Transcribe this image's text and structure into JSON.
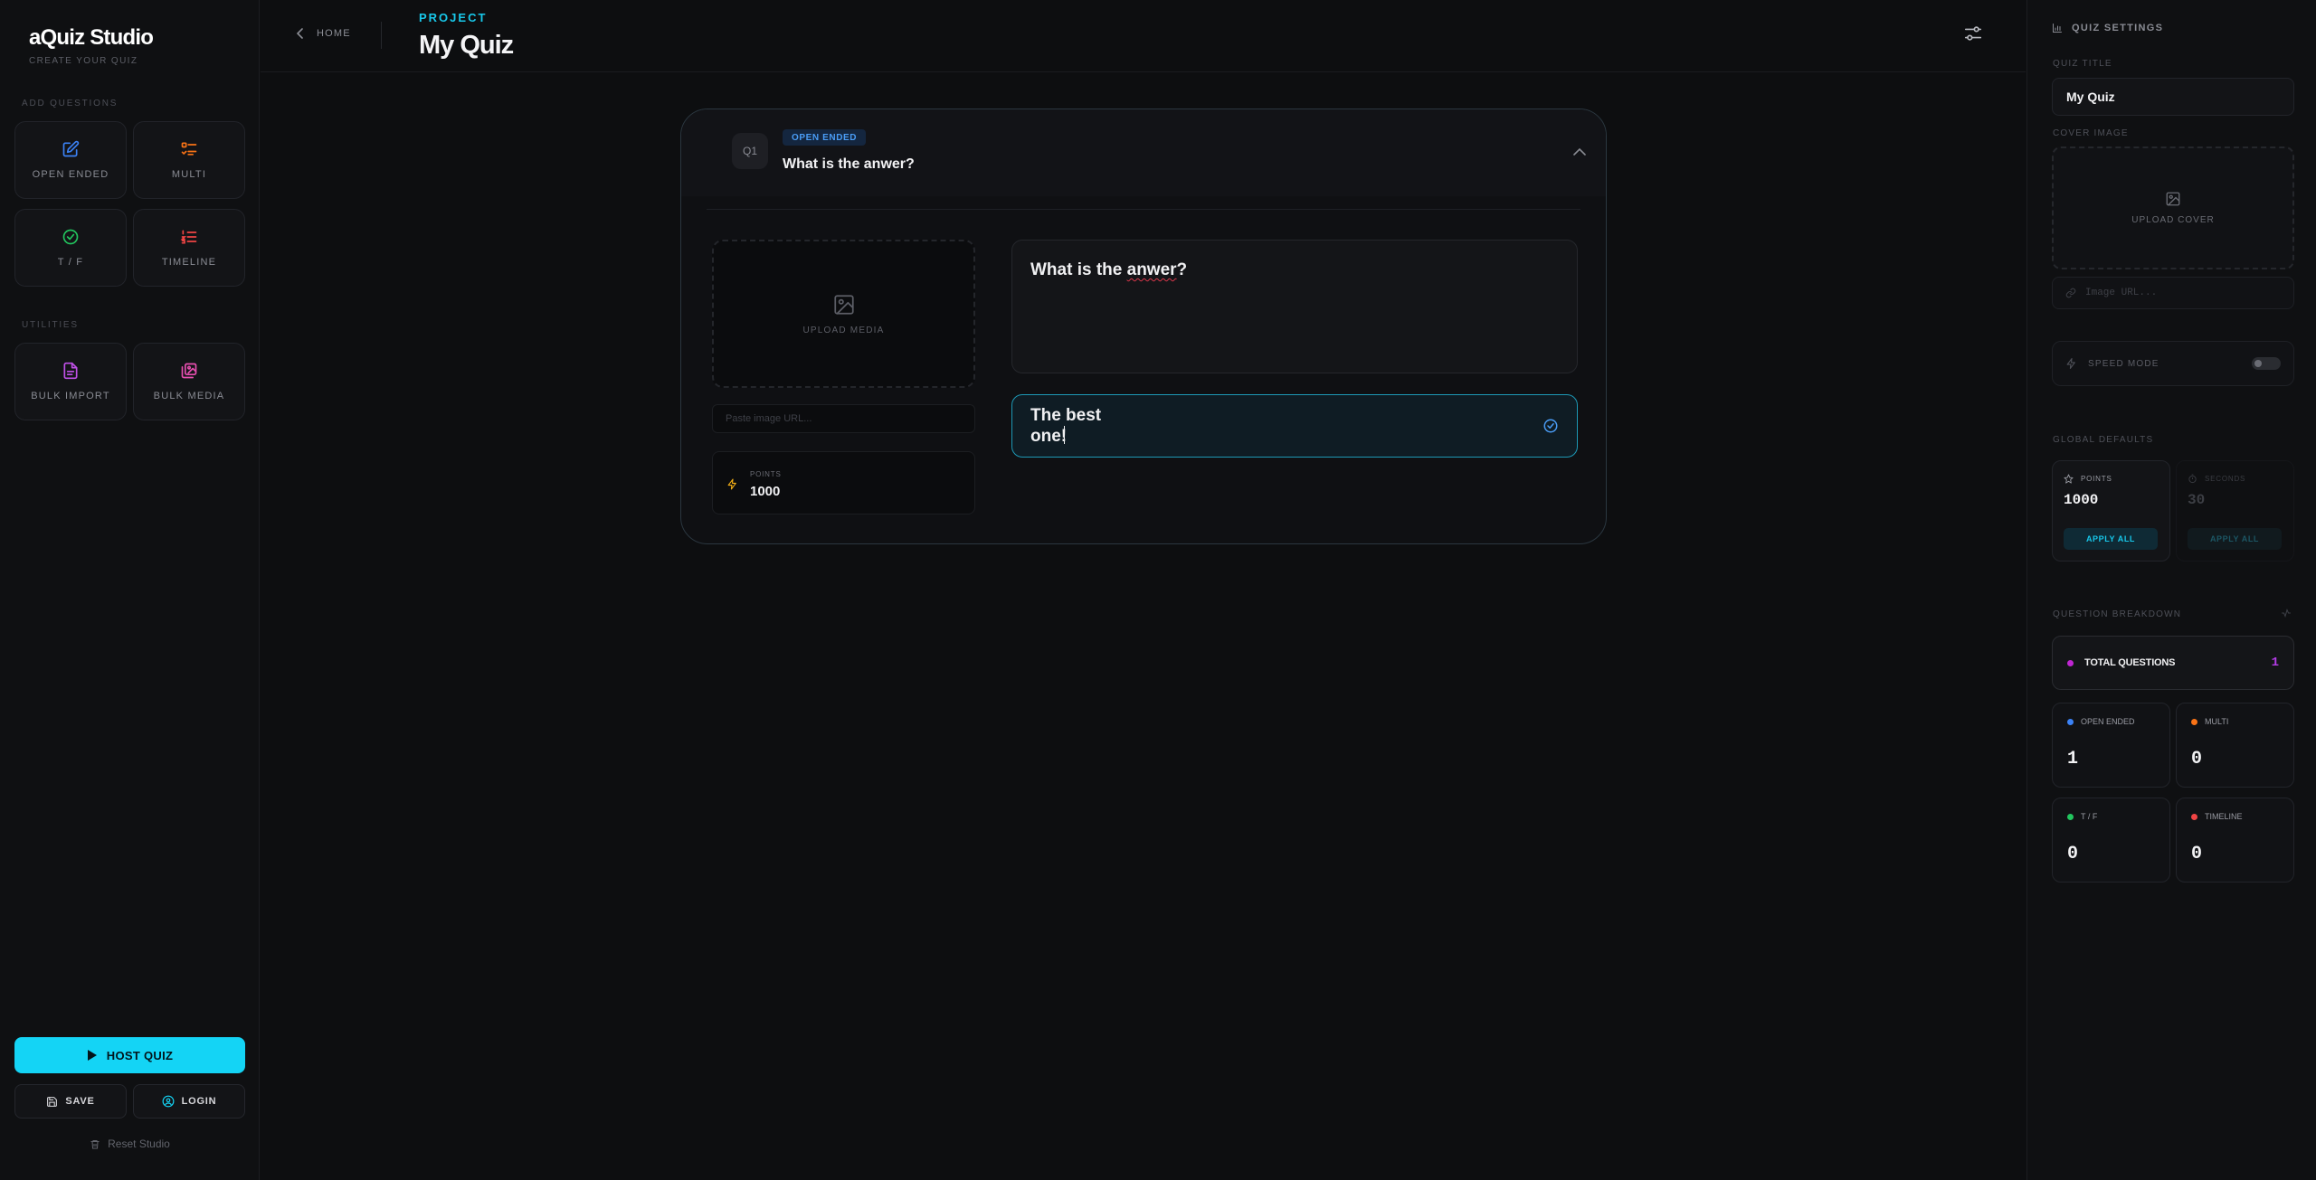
{
  "sidebar": {
    "brand": "aQuiz Studio",
    "tagline": "CREATE YOUR QUIZ",
    "add_questions_label": "ADD QUESTIONS",
    "utilities_label": "UTILITIES",
    "tiles": {
      "open_ended": {
        "label": "OPEN ENDED",
        "icon": "edit-icon",
        "color": "#3b82f6"
      },
      "multi": {
        "label": "MULTI",
        "icon": "list-icon",
        "color": "#f97316"
      },
      "tf": {
        "label": "T / F",
        "icon": "check-circle-icon",
        "color": "#22c55e"
      },
      "timeline": {
        "label": "TIMELINE",
        "icon": "ordered-list-icon",
        "color": "#ef4444"
      },
      "bulk_import": {
        "label": "BULK IMPORT",
        "icon": "document-icon",
        "color": "#c050e8"
      },
      "bulk_media": {
        "label": "BULK MEDIA",
        "icon": "images-icon",
        "color": "#e84fb0"
      }
    },
    "host_quiz": "HOST QUIZ",
    "save": "SAVE",
    "login": "LOGIN",
    "reset": "Reset Studio"
  },
  "header": {
    "back": "HOME",
    "project_label": "PROJECT",
    "project_title": "My Quiz"
  },
  "question": {
    "number": "Q1",
    "type_badge": "OPEN ENDED",
    "title": "What is the anwer?",
    "text_before": "What is the ",
    "text_misspelled": "anwer",
    "text_after": "?",
    "upload_media": "UPLOAD MEDIA",
    "image_url_placeholder": "Paste image URL...",
    "points_label": "POINTS",
    "points_value": "1000",
    "answer": "The best one!"
  },
  "settings": {
    "title": "QUIZ SETTINGS",
    "quiz_title_label": "QUIZ TITLE",
    "quiz_title_value": "My Quiz",
    "cover_image_label": "COVER IMAGE",
    "upload_cover": "UPLOAD COVER",
    "image_url_placeholder": "Image URL...",
    "speed_mode": "SPEED MODE",
    "speed_mode_on": false,
    "global_defaults_label": "GLOBAL DEFAULTS",
    "points_label": "POINTS",
    "points_value": "1000",
    "seconds_label": "SECONDS",
    "seconds_value": "30",
    "apply_all": "APPLY ALL",
    "breakdown_label": "QUESTION BREAKDOWN",
    "total_label": "TOTAL QUESTIONS",
    "total_value": "1",
    "stats": {
      "open_ended": {
        "label": "OPEN ENDED",
        "value": "1",
        "color": "#3b82f6"
      },
      "multi": {
        "label": "MULTI",
        "value": "0",
        "color": "#f97316"
      },
      "tf": {
        "label": "T / F",
        "value": "0",
        "color": "#22c55e"
      },
      "timeline": {
        "label": "TIMELINE",
        "value": "0",
        "color": "#ef4444"
      }
    }
  },
  "colors": {
    "accent": "#14d4f5",
    "total_dot": "#c026d3"
  }
}
